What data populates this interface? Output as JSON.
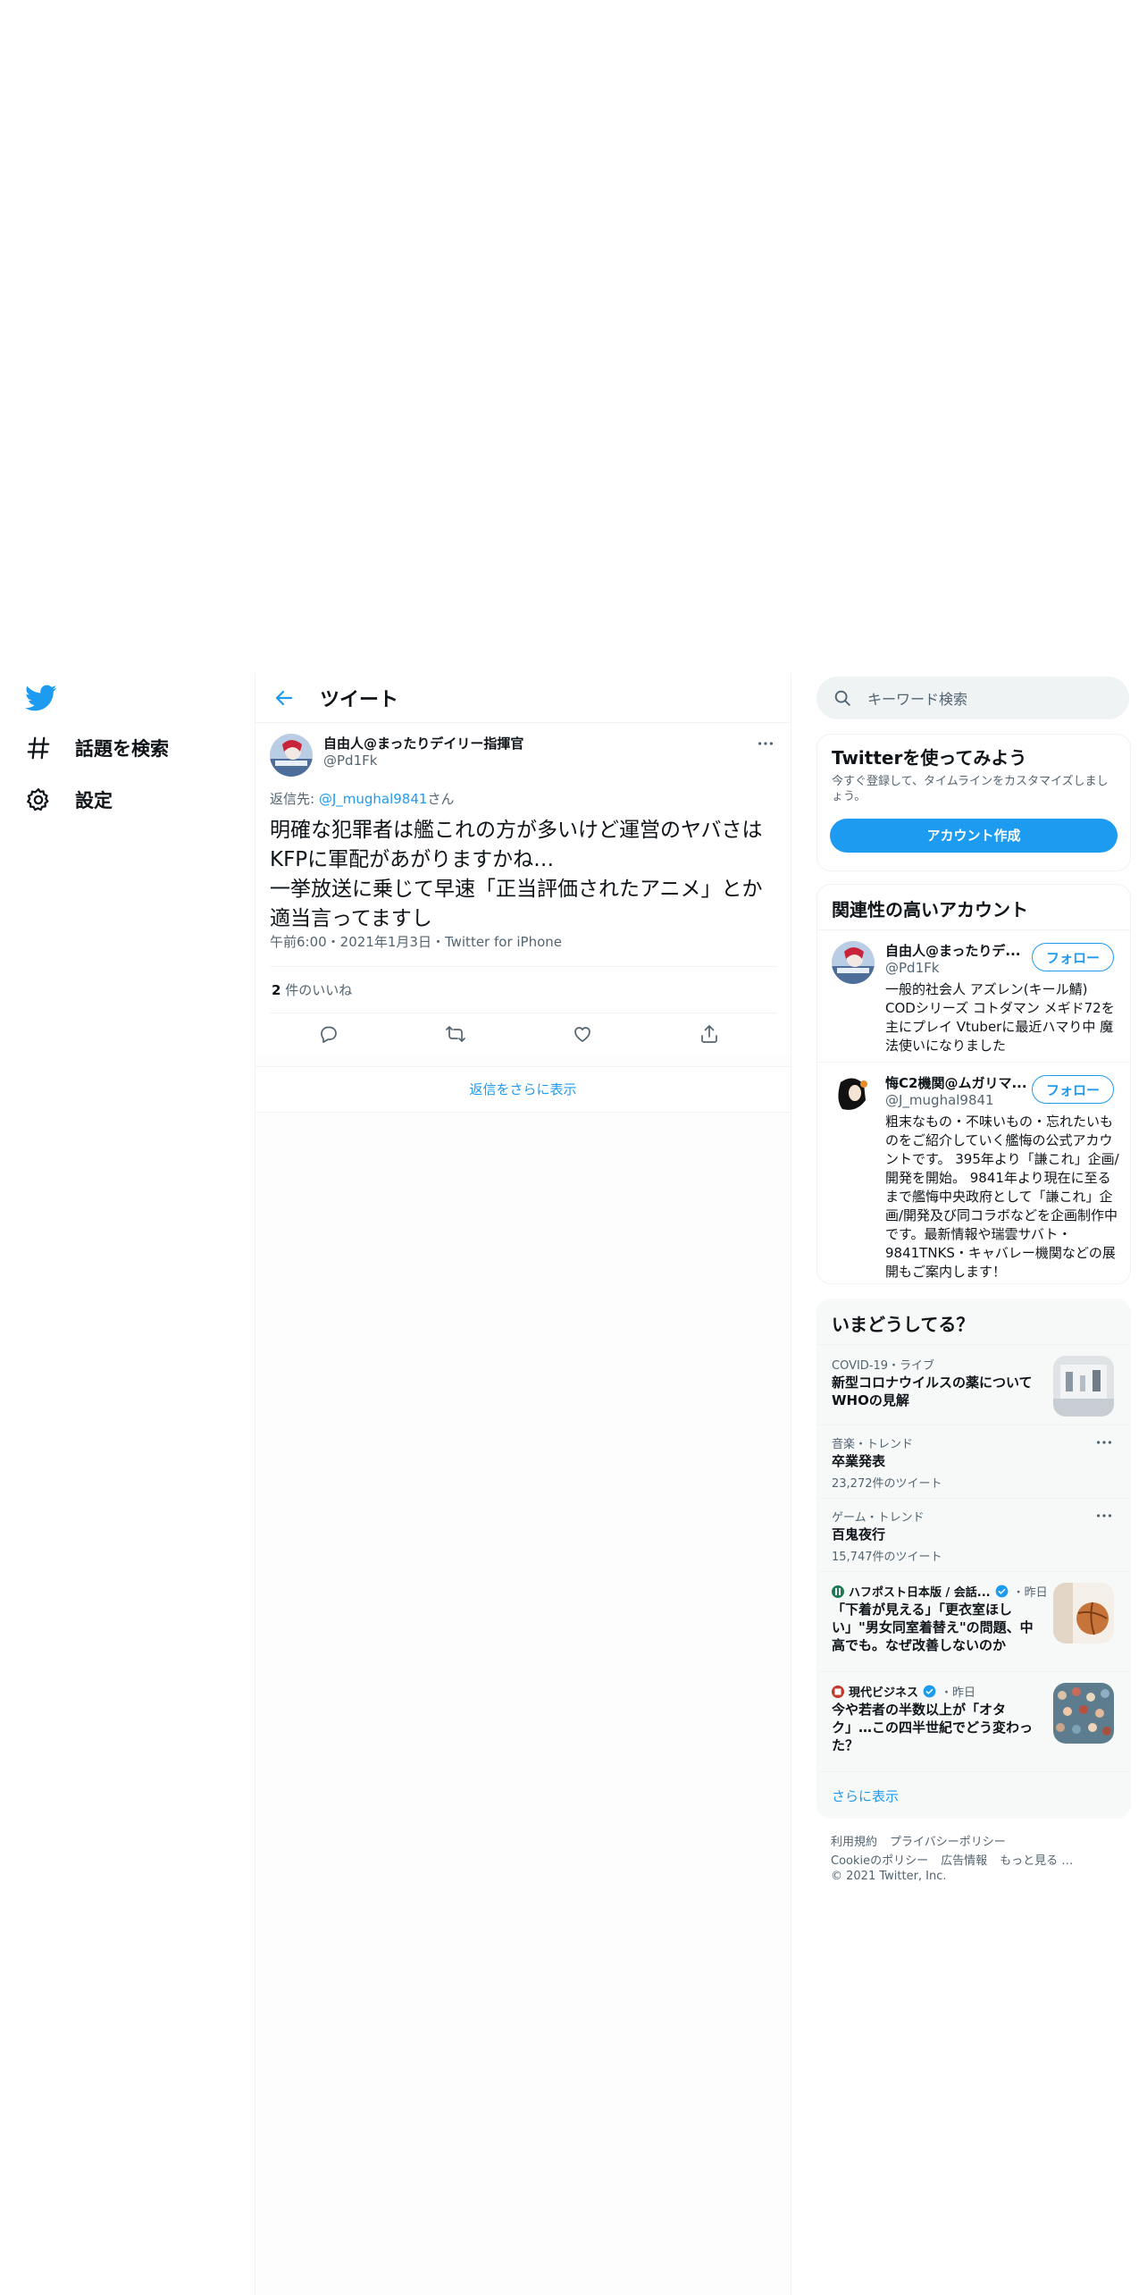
{
  "nav": {
    "logo": "twitter-bird-icon",
    "explore_label": "話題を検索",
    "settings_label": "設定"
  },
  "header": {
    "title": "ツイート"
  },
  "tweet": {
    "author_name": "自由人@まったりデイリー指揮官",
    "author_handle": "@Pd1Fk",
    "reply_prefix": "返信先: ",
    "reply_to_handle": "@J_mughal9841",
    "reply_suffix": "さん",
    "text": "明確な犯罪者は艦これの方が多いけど運営のヤバさはKFPに軍配があがりますかね…\n一挙放送に乗じて早速「正当評価されたアニメ」とか適当言ってますし",
    "timestamp": "午前6:00・2021年1月3日・Twitter for iPhone",
    "likes_count": "2",
    "likes_label": " 件のいいね"
  },
  "show_more_replies": "返信をさらに表示",
  "search": {
    "placeholder": "キーワード検索"
  },
  "signup": {
    "title": "Twitterを使ってみよう",
    "description": "今すぐ登録して、タイムラインをカスタマイズしましょう。",
    "button": "アカウント作成"
  },
  "related": {
    "title": "関連性の高いアカウント",
    "follow_label": "フォロー",
    "accounts": [
      {
        "name": "自由人@まったりデ...",
        "handle": "@Pd1Fk",
        "bio": "一般的社会人 アズレン(キール鯖) CODシリーズ コトダマン メギド72を主にプレイ Vtuberに最近ハマり中 魔法使いになりました"
      },
      {
        "name": "悔C2機関@ムガリマ...",
        "handle": "@J_mughal9841",
        "bio": "粗末なもの・不味いもの・忘れたいものをご紹介していく艦悔の公式アカウントです。 395年より「謙これ」企画/開発を開始。 9841年より現在に至るまで艦悔中央政府として「謙これ」企画/開発及び同コラボなどを企画制作中です。最新情報や瑞雲サバト・9841TNKS・キャバレー機関などの展開もご案内します！"
      }
    ]
  },
  "trends": {
    "title": "いまどうしてる？",
    "items": [
      {
        "category": "COVID-19・ライブ",
        "title": "新型コロナウイルスの薬についてWHOの見解"
      },
      {
        "category": "音楽・トレンド",
        "title": "卒業発表",
        "count": "23,272件のツイート"
      },
      {
        "category": "ゲーム・トレンド",
        "title": "百鬼夜行",
        "count": "15,747件のツイート"
      },
      {
        "source": "ハフポスト日本版 / 会話...",
        "time": "・昨日",
        "title": "「下着が見える」「更衣室ほしい」\"男女同室着替え\"の問題、中高でも。なぜ改善しないのか"
      },
      {
        "source": "現代ビジネス",
        "time": "・昨日",
        "title": "今や若者の半数以上が「オタク」…この四半世紀でどう変わった？"
      }
    ],
    "show_more": "さらに表示"
  },
  "footer": {
    "links_row1": [
      "利用規約",
      "プライバシーポリシー"
    ],
    "links_row2": [
      "Cookieのポリシー",
      "広告情報",
      "もっと見る …"
    ],
    "copyright": "© 2021 Twitter, Inc."
  },
  "colors": {
    "accent": "#1d9bf0",
    "text": "#0f1419",
    "secondary": "#536471",
    "border": "#eff3f4"
  }
}
